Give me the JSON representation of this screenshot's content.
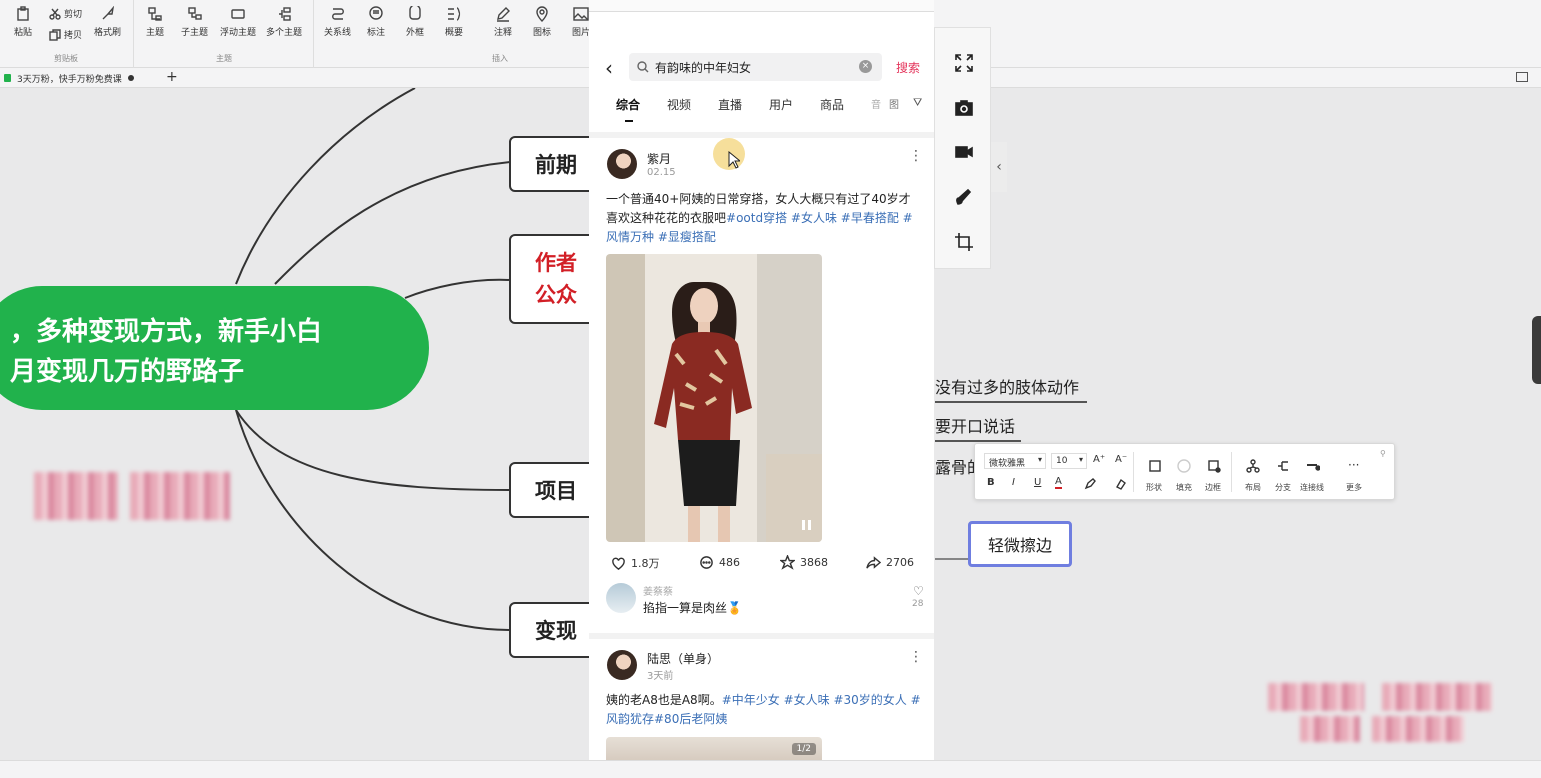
{
  "ribbon": {
    "clipboard": {
      "paste": "粘贴",
      "cut": "剪切",
      "copy": "拷贝",
      "format_painter": "格式刷",
      "group": "剪贴板"
    },
    "topic": {
      "main": "主题",
      "sub": "子主题",
      "floating": "浮动主题",
      "multi": "多个主题",
      "group": "主题"
    },
    "insert": {
      "relation": "关系线",
      "callout": "标注",
      "boundary": "外框",
      "summary": "概要",
      "note": "注释",
      "marker": "图标",
      "image": "图片",
      "group": "插入"
    }
  },
  "tabs": {
    "doc_title": "3天万粉，快手万粉免费课",
    "add": "+"
  },
  "mindmap": {
    "central_line1": "，多种变现方式，新手小白",
    "central_line2": "月变现几万的野路子",
    "topic1": "前期",
    "topic2_line1": "作者",
    "topic2_line2": "公众",
    "topic3": "项目",
    "topic4": "变现",
    "right_text1": "没有过多的肢体动作",
    "right_text2": "要开口说话",
    "right_text3": "露骨的",
    "selected_node": "轻微擦边"
  },
  "phone": {
    "search_query": "有韵味的中年妇女",
    "search_button": "搜索",
    "categories": [
      "综合",
      "视频",
      "直播",
      "用户",
      "商品",
      "音",
      "图"
    ],
    "post1": {
      "user": "紫月",
      "date": "02.15",
      "text": "一个普通40+阿姨的日常穿搭，女人大概只有过了40岁才喜欢这种花花的衣服吧",
      "tags": "#ootd穿搭 #女人味 #早春搭配 #风情万种 #显瘦搭配",
      "likes": "1.8万",
      "comments": "486",
      "stars": "3868",
      "shares": "2706",
      "comment_user": "姜蔡蔡",
      "comment_text": "掐指一算是肉丝🏅",
      "comment_likes": "28"
    },
    "post2": {
      "user": "陆思（单身）",
      "date": "3天前",
      "text": "姨的老A8也是A8啊。",
      "tags": "#中年少女 #女人味 #30岁的女人 #风韵犹存#80后老阿姨",
      "page_indicator": "1/2"
    }
  },
  "format_bar": {
    "font": "微软雅黑",
    "size": "10",
    "bold": "B",
    "italic": "I",
    "underline": "U",
    "font_color": "A",
    "shape": "形状",
    "fill": "填充",
    "border": "边框",
    "layout": "布局",
    "branch": "分支",
    "connector": "连接线",
    "more": "更多",
    "more_dots": "···"
  },
  "colors": {
    "central": "#21b24c",
    "accent": "#e4335a",
    "tag": "#3b6fb6",
    "selection": "#6f7ee0"
  }
}
